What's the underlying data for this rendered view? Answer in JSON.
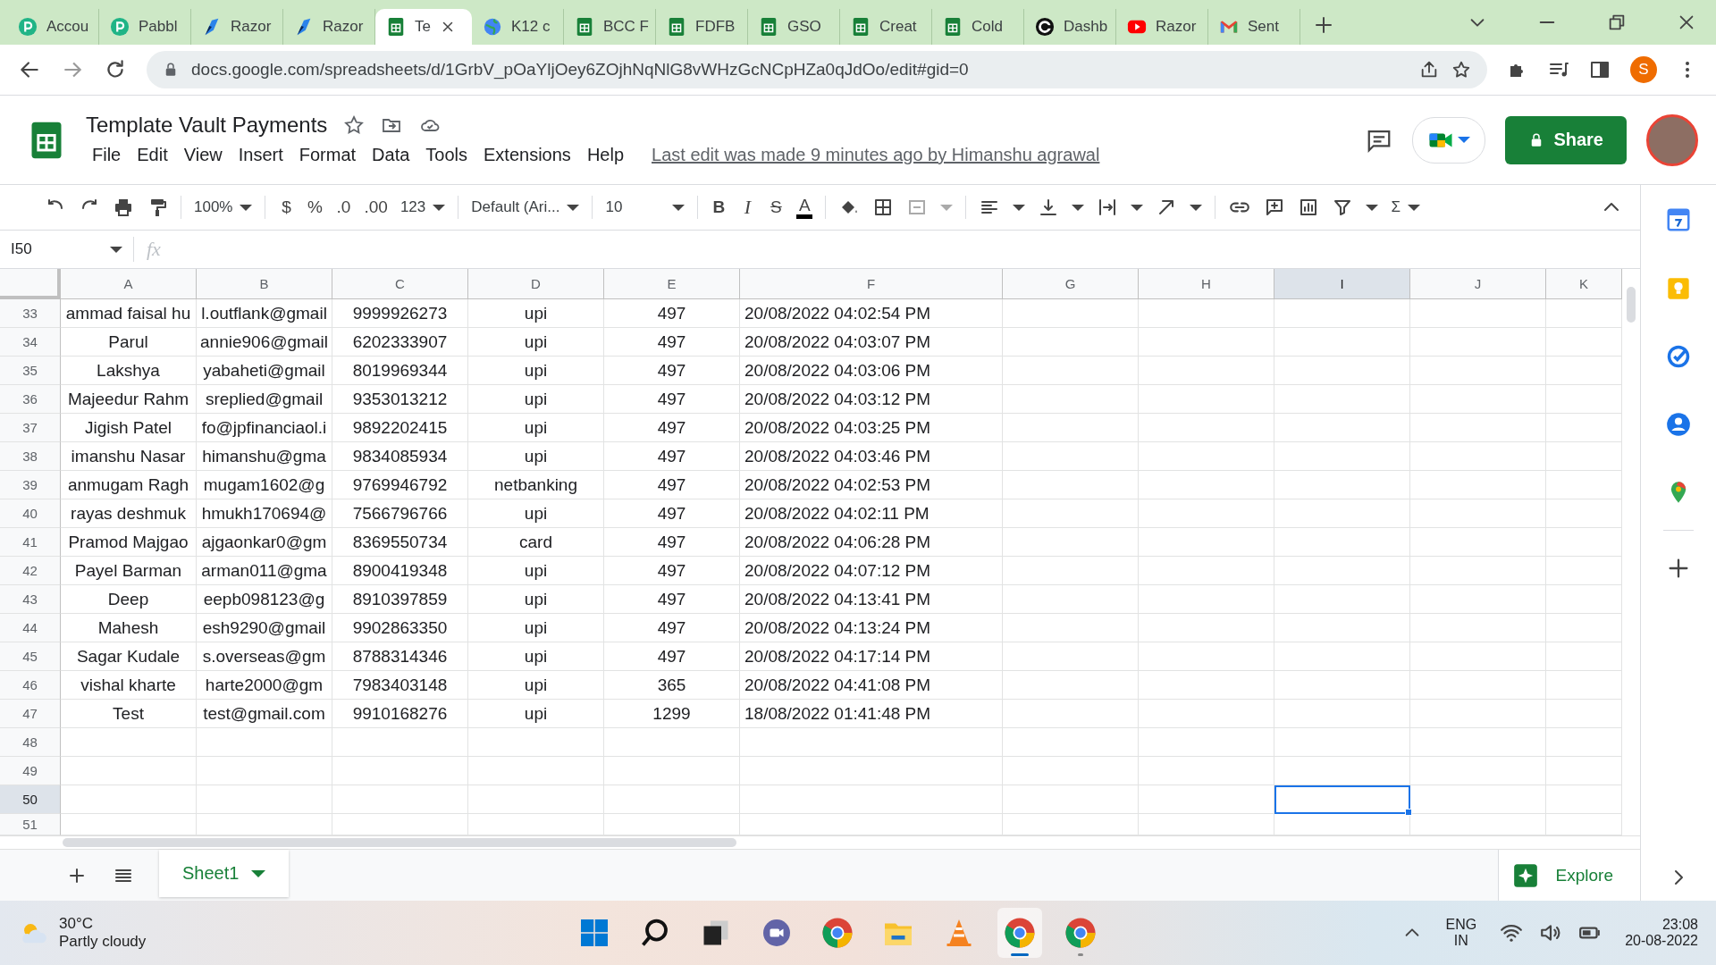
{
  "browser": {
    "tabs": [
      {
        "label": "Accou",
        "kind": "pabbly",
        "selected": false
      },
      {
        "label": "Pabbl",
        "kind": "pabbly",
        "selected": false
      },
      {
        "label": "Razor",
        "kind": "razor",
        "selected": false
      },
      {
        "label": "Razor",
        "kind": "razor",
        "selected": false
      },
      {
        "label": "Te",
        "kind": "sheets",
        "selected": true
      },
      {
        "label": "K12 c",
        "kind": "globe",
        "selected": false
      },
      {
        "label": "BCC F",
        "kind": "sheets",
        "selected": false
      },
      {
        "label": "FDFB",
        "kind": "sheets",
        "selected": false
      },
      {
        "label": "GSO",
        "kind": "sheets",
        "selected": false
      },
      {
        "label": "Creat",
        "kind": "sheets",
        "selected": false
      },
      {
        "label": "Cold",
        "kind": "sheets",
        "selected": false
      },
      {
        "label": "Dashb",
        "kind": "ring",
        "selected": false
      },
      {
        "label": "Razor",
        "kind": "video",
        "selected": false
      },
      {
        "label": "Sent",
        "kind": "mail",
        "selected": false
      }
    ],
    "address": "docs.google.com/spreadsheets/d/1GrbV_pOaYljOey6ZOjhNqNlG8vWHzGcNCpHZa0qJdOo/edit#gid=0",
    "profile_initial": "S"
  },
  "doc": {
    "title": "Template Vault Payments",
    "menu": [
      "File",
      "Edit",
      "View",
      "Insert",
      "Format",
      "Data",
      "Tools",
      "Extensions",
      "Help"
    ],
    "last_edit": "Last edit was made 9 minutes ago by Himanshu agrawal",
    "share": "Share"
  },
  "toolbar": {
    "zoom": "100%",
    "currency": "$",
    "percent": "%",
    "decrease_decimals": ".0",
    "increase_decimals": ".00",
    "number_format": "123",
    "font": "Default (Ari...",
    "font_size": "10",
    "bold": "B",
    "italic": "I",
    "strike": "S",
    "text_color": "A",
    "functions": "Σ"
  },
  "formula_bar": {
    "name_box": "I50",
    "fx": "fx"
  },
  "sheet": {
    "columns": [
      {
        "label": "A",
        "selected": false
      },
      {
        "label": "B",
        "selected": false
      },
      {
        "label": "C",
        "selected": false
      },
      {
        "label": "D",
        "selected": false
      },
      {
        "label": "E",
        "selected": false
      },
      {
        "label": "F",
        "selected": false
      },
      {
        "label": "G",
        "selected": false
      },
      {
        "label": "H",
        "selected": false
      },
      {
        "label": "I",
        "selected": true
      },
      {
        "label": "J",
        "selected": false
      },
      {
        "label": "K",
        "selected": false
      }
    ],
    "rows": [
      {
        "number": "33",
        "selected": false,
        "cells": [
          "ammad faisal hu",
          "l.outflank@gmail",
          "9999926273",
          "upi",
          "497",
          "20/08/2022 04:02:54 PM"
        ]
      },
      {
        "number": "34",
        "selected": false,
        "cells": [
          "Parul",
          "annie906@gmail",
          "6202333907",
          "upi",
          "497",
          "20/08/2022 04:03:07 PM"
        ]
      },
      {
        "number": "35",
        "selected": false,
        "cells": [
          "Lakshya",
          "yabaheti@gmail",
          "8019969344",
          "upi",
          "497",
          "20/08/2022 04:03:06 PM"
        ]
      },
      {
        "number": "36",
        "selected": false,
        "cells": [
          "Majeedur Rahm",
          "sreplied@gmail",
          "9353013212",
          "upi",
          "497",
          "20/08/2022 04:03:12 PM"
        ]
      },
      {
        "number": "37",
        "selected": false,
        "cells": [
          "Jigish Patel",
          "fo@jpfinanciaol.i",
          "9892202415",
          "upi",
          "497",
          "20/08/2022 04:03:25 PM"
        ]
      },
      {
        "number": "38",
        "selected": false,
        "cells": [
          "imanshu Nasar",
          "himanshu@gma",
          "9834085934",
          "upi",
          "497",
          "20/08/2022 04:03:46 PM"
        ]
      },
      {
        "number": "39",
        "selected": false,
        "cells": [
          "anmugam Ragh",
          "mugam1602@g",
          "9769946792",
          "netbanking",
          "497",
          "20/08/2022 04:02:53 PM"
        ]
      },
      {
        "number": "40",
        "selected": false,
        "cells": [
          "rayas deshmuk",
          "hmukh170694@",
          "7566796766",
          "upi",
          "497",
          "20/08/2022 04:02:11 PM"
        ]
      },
      {
        "number": "41",
        "selected": false,
        "cells": [
          "Pramod Majgao",
          "ajgaonkar0@gm",
          "8369550734",
          "card",
          "497",
          "20/08/2022 04:06:28 PM"
        ]
      },
      {
        "number": "42",
        "selected": false,
        "cells": [
          "Payel Barman",
          "arman011@gma",
          "8900419348",
          "upi",
          "497",
          "20/08/2022 04:07:12 PM"
        ]
      },
      {
        "number": "43",
        "selected": false,
        "cells": [
          "Deep",
          "eepb098123@g",
          "8910397859",
          "upi",
          "497",
          "20/08/2022 04:13:41 PM"
        ]
      },
      {
        "number": "44",
        "selected": false,
        "cells": [
          "Mahesh",
          "esh9290@gmail",
          "9902863350",
          "upi",
          "497",
          "20/08/2022 04:13:24 PM"
        ]
      },
      {
        "number": "45",
        "selected": false,
        "cells": [
          "Sagar Kudale",
          "s.overseas@gm",
          "8788314346",
          "upi",
          "497",
          "20/08/2022 04:17:14 PM"
        ]
      },
      {
        "number": "46",
        "selected": false,
        "cells": [
          "vishal kharte",
          "harte2000@gm",
          "7983403148",
          "upi",
          "365",
          "20/08/2022 04:41:08 PM"
        ]
      },
      {
        "number": "47",
        "selected": false,
        "cells": [
          "Test",
          "test@gmail.com",
          "9910168276",
          "upi",
          "1299",
          "18/08/2022 01:41:48 PM"
        ]
      },
      {
        "number": "48",
        "selected": false,
        "cells": []
      },
      {
        "number": "49",
        "selected": false,
        "cells": []
      },
      {
        "number": "50",
        "selected": true,
        "cells": []
      },
      {
        "number": "51",
        "selected": false,
        "cells": []
      }
    ]
  },
  "sheet_tabs": [
    {
      "label": "Sheet1",
      "selected": true
    }
  ],
  "explore": "Explore",
  "taskbar": {
    "temperature": "30°C",
    "weather": "Partly cloudy",
    "apps": [
      {
        "kind": "start",
        "running": false,
        "focused": false
      },
      {
        "kind": "search",
        "running": false,
        "focused": false
      },
      {
        "kind": "taskview",
        "running": false,
        "focused": false
      },
      {
        "kind": "chat",
        "running": false,
        "focused": false
      },
      {
        "kind": "chrome",
        "running": false,
        "focused": false
      },
      {
        "kind": "folder",
        "running": false,
        "focused": false
      },
      {
        "kind": "cone",
        "running": false,
        "focused": false
      },
      {
        "kind": "chrome",
        "running": true,
        "focused": true
      },
      {
        "kind": "chrome",
        "running": true,
        "focused": false
      }
    ],
    "lang": "ENG",
    "region": "IN",
    "time": "23:08",
    "date": "20-08-2022"
  }
}
